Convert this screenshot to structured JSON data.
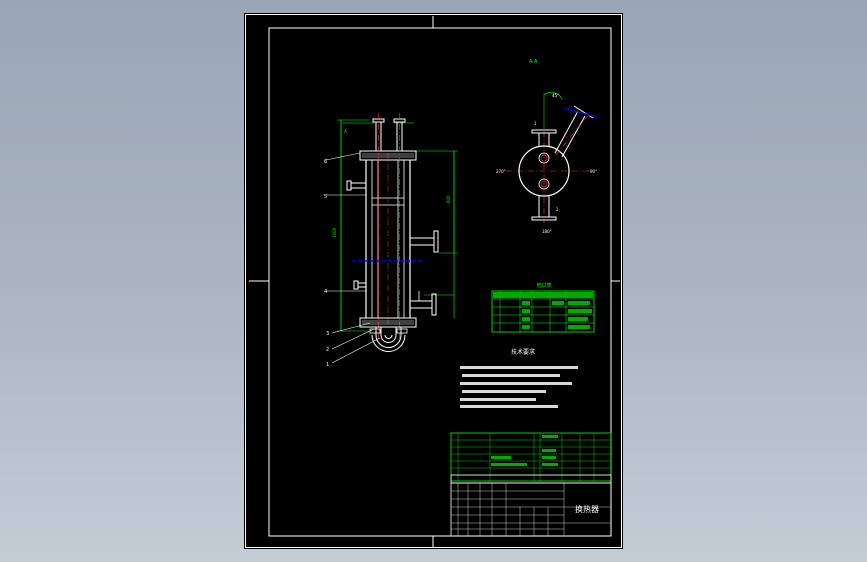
{
  "drawing": {
    "title": "换热器",
    "colors": {
      "background": "#000000",
      "border": "#ffffff",
      "outline": "#ffffff",
      "dimension": "#00ff00",
      "centerline": "#ff3030",
      "hatch": "#0000ff",
      "callout": "#ffffff",
      "table": "#00ff00",
      "tableFill": "#00aa00"
    },
    "view_label": "A-A",
    "tech_req_title": "技术要求",
    "nozzle_table_title": "管口表"
  }
}
